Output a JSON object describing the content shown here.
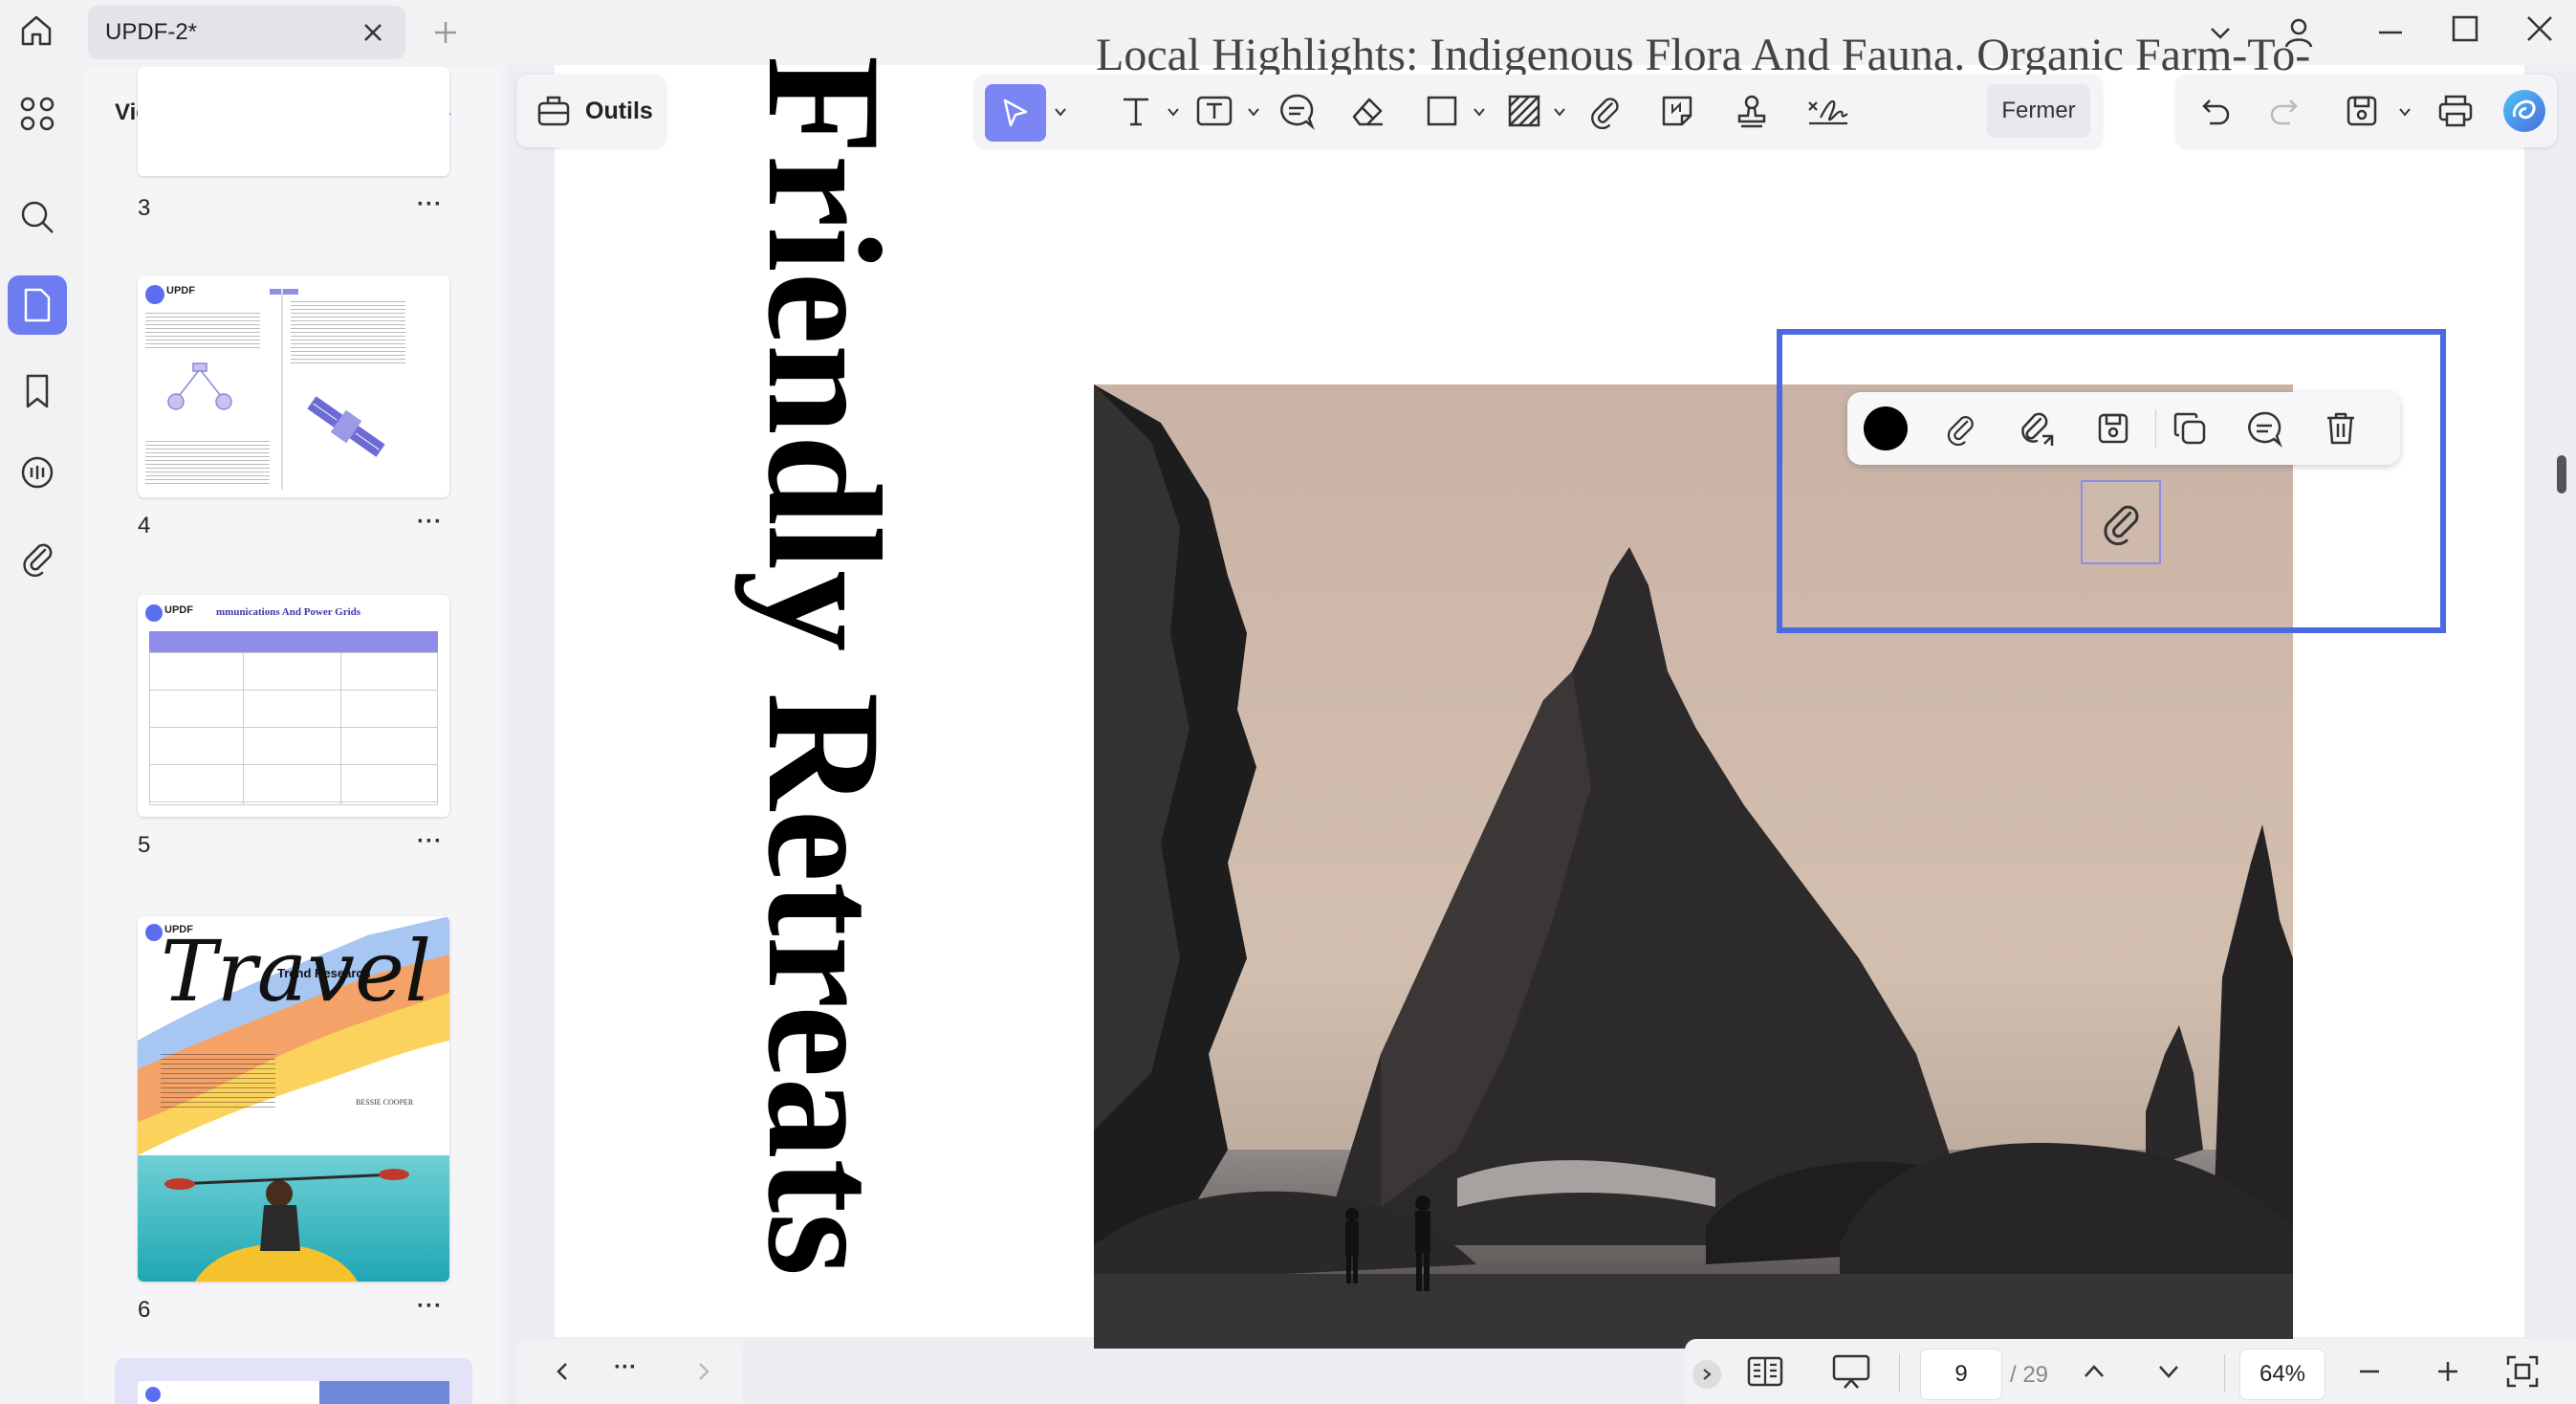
{
  "app": {
    "tab_title": "UPDF-2*"
  },
  "thumbnails_panel": {
    "title": "Vignettes",
    "pages": [
      {
        "number": "3",
        "more": "···"
      },
      {
        "number": "4",
        "more": "···"
      },
      {
        "number": "5",
        "more": "···"
      },
      {
        "number": "6",
        "more": "···"
      }
    ],
    "thumb4": {
      "brand": "UPDF"
    },
    "thumb5": {
      "brand": "UPDF",
      "title": "mmunications And Power Grids"
    },
    "thumb6": {
      "brand": "UPDF",
      "script": "Travel",
      "subtitle": "Trend Research",
      "author": "BESSIE COOPER"
    }
  },
  "toolbar": {
    "tools_label": "Outils",
    "close_label": "Fermer"
  },
  "document": {
    "heading": "Local Highlights: Indigenous Flora And Fauna. Organic Farm-To-Table Dining Experiences",
    "vertical_title": "Friendly Retreats"
  },
  "bottom_nav": {
    "more": "···"
  },
  "pagination": {
    "current_page": "9",
    "total": "/ 29",
    "zoom": "64%"
  },
  "colors": {
    "accent": "#6e7cf2",
    "selection_border": "#4b6ae0",
    "photo_sky": "#c9b3a6"
  }
}
